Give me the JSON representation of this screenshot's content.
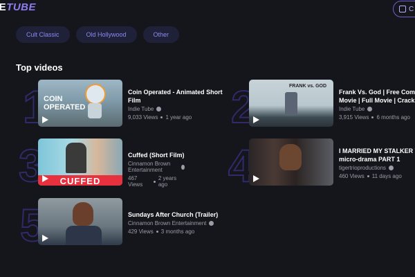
{
  "header": {
    "logo_part_a": "IE",
    "logo_part_b": "TUBE",
    "button_label": "C"
  },
  "chips": [
    "Cult Classic",
    "Old Hollywood",
    "Other"
  ],
  "section_title": "Top videos",
  "videos": [
    {
      "rank": "1",
      "title_line1": "Coin Operated - Animated Short",
      "title_line2": "Film",
      "channel": "Indie Tube",
      "views": "9,033 Views",
      "age": "1 year ago",
      "thumb_text": "COIN OPERATED"
    },
    {
      "rank": "2",
      "title_line1": "Frank Vs. God | Free Come",
      "title_line2": "Movie | Full Movie | Crack U",
      "channel": "Indie Tube",
      "views": "3,915 Views",
      "age": "6 months ago",
      "thumb_text": "FRANK vs. GOD"
    },
    {
      "rank": "3",
      "title_line1": "Cuffed (Short Film)",
      "title_line2": "",
      "channel": "Cinnamon Brown Entertainment",
      "views": "467 Views",
      "age": "2 years ago",
      "thumb_text": "CUFFED"
    },
    {
      "rank": "4",
      "title_line1": "I MARRIED MY STALKER Ve",
      "title_line2": "micro-drama PART 1",
      "channel": "tigertrioproductions",
      "views": "460 Views",
      "age": "11 days ago",
      "thumb_text": ""
    },
    {
      "rank": "5",
      "title_line1": "Sundays After Church (Trailer)",
      "title_line2": "",
      "channel": "Cinnamon Brown Entertainment",
      "views": "429 Views",
      "age": "3 months ago",
      "thumb_text": ""
    }
  ]
}
